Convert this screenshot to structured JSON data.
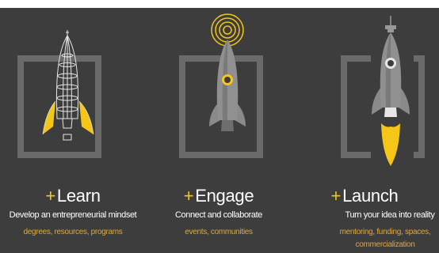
{
  "colors": {
    "background": "#3d3d3d",
    "frame": "#6a6a6a",
    "accent": "#f5c518",
    "link": "#e0a830",
    "text": "#ffffff"
  },
  "columns": [
    {
      "id": "learn",
      "icon": "wireframe-rocket-icon",
      "plus": "+",
      "title": "Learn",
      "description": "Develop an entrepreneurial mindset",
      "links": [
        "degrees, resources, programs"
      ]
    },
    {
      "id": "engage",
      "icon": "rocket-with-signal-icon",
      "plus": "+",
      "title": "Engage",
      "description": "Connect and collaborate",
      "links": [
        "events, communities"
      ]
    },
    {
      "id": "launch",
      "icon": "rocket-launching-icon",
      "plus": "+",
      "title": "Launch",
      "description": "Turn your idea into reality",
      "links": [
        "mentoring, funding, spaces,",
        "commercialization"
      ]
    }
  ]
}
